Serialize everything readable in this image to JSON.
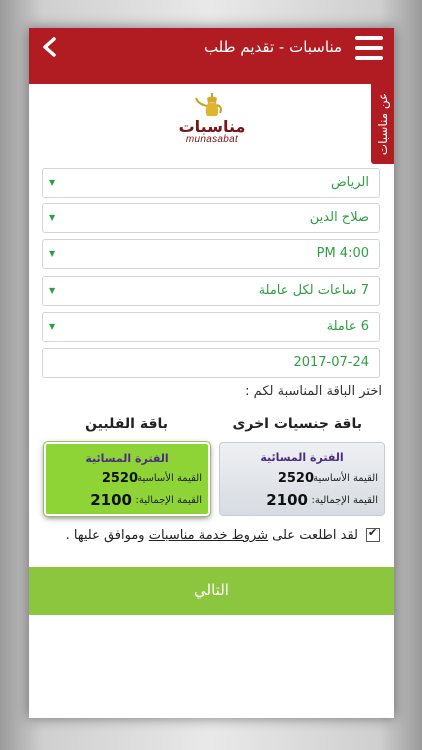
{
  "appbar": {
    "title": "مناسبات - تقديم طلب"
  },
  "side_tab": {
    "label": "عن مناسبات"
  },
  "logo": {
    "arabic": "مناسبات",
    "latin": "munasabat"
  },
  "form": {
    "city": "الرياض",
    "district": "صلاح الدين",
    "time": "PM 4:00",
    "hours": "7 ساعات لكل عاملة",
    "workers": "6 عاملة",
    "date": "2017-07-24"
  },
  "packages": {
    "prompt": "اختر الباقة المناسبة لكم :",
    "other": {
      "title": "باقة جنسيات اخرى",
      "period": "الفترة المسائية",
      "base_label": "القيمة الأساسية:",
      "base_value": "2520",
      "total_label": "القيمة الإجمالية:",
      "total_value": "2100"
    },
    "philippines": {
      "title": "باقة الفلبين",
      "period": "الفترة المسائية",
      "base_label": "القيمة الأساسية:",
      "base_value": "2520",
      "total_label": "القيمة الإجمالية:",
      "total_value": "2100"
    }
  },
  "terms": {
    "prefix": "لقد اطلعت على",
    "link": "شروط خدمة مناسبات",
    "suffix": "وموافق عليها ."
  },
  "next_button": "التالي",
  "colors": {
    "brand_red": "#b11c22",
    "accent_green": "#8cc63f",
    "field_text": "#2ea043",
    "period_purple": "#4a2d83"
  }
}
